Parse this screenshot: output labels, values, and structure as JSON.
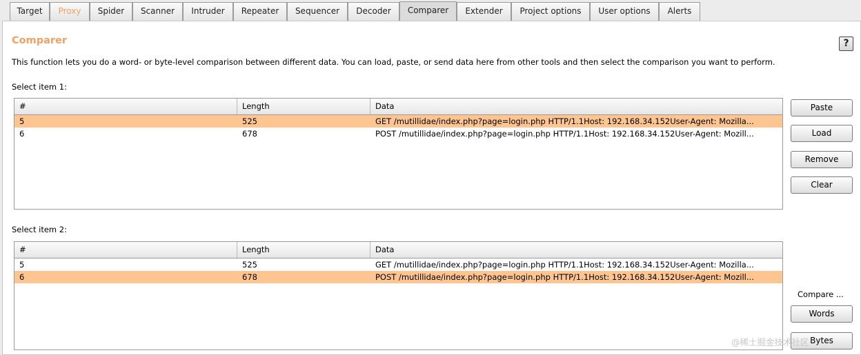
{
  "tabs": [
    "Target",
    "Proxy",
    "Spider",
    "Scanner",
    "Intruder",
    "Repeater",
    "Sequencer",
    "Decoder",
    "Comparer",
    "Extender",
    "Project options",
    "User options",
    "Alerts"
  ],
  "active_tab": "Comparer",
  "page": {
    "title": "Comparer",
    "help_label": "?",
    "description": "This function lets you do a word- or byte-level comparison between different data. You can load, paste, or send data here from other tools and then select the comparison you want to perform."
  },
  "columns": {
    "num": "#",
    "length": "Length",
    "data": "Data"
  },
  "item1": {
    "label": "Select item 1:",
    "rows": [
      {
        "num": "5",
        "length": "525",
        "data": "GET /mutillidae/index.php?page=login.php HTTP/1.1Host: 192.168.34.152User-Agent: Mozilla...",
        "selected": true
      },
      {
        "num": "6",
        "length": "678",
        "data": "POST /mutillidae/index.php?page=login.php HTTP/1.1Host: 192.168.34.152User-Agent: Mozill...",
        "selected": false
      }
    ]
  },
  "item2": {
    "label": "Select item 2:",
    "rows": [
      {
        "num": "5",
        "length": "525",
        "data": "GET /mutillidae/index.php?page=login.php HTTP/1.1Host: 192.168.34.152User-Agent: Mozilla...",
        "selected": false
      },
      {
        "num": "6",
        "length": "678",
        "data": "POST /mutillidae/index.php?page=login.php HTTP/1.1Host: 192.168.34.152User-Agent: Mozill...",
        "selected": true
      }
    ]
  },
  "buttons": {
    "paste": "Paste",
    "load": "Load",
    "remove": "Remove",
    "clear": "Clear",
    "words": "Words",
    "bytes": "Bytes"
  },
  "compare_label": "Compare ...",
  "watermark": "@稀土掘金技术社区",
  "colors": {
    "accent": "#f2a063",
    "selected_row": "#ffc591"
  }
}
